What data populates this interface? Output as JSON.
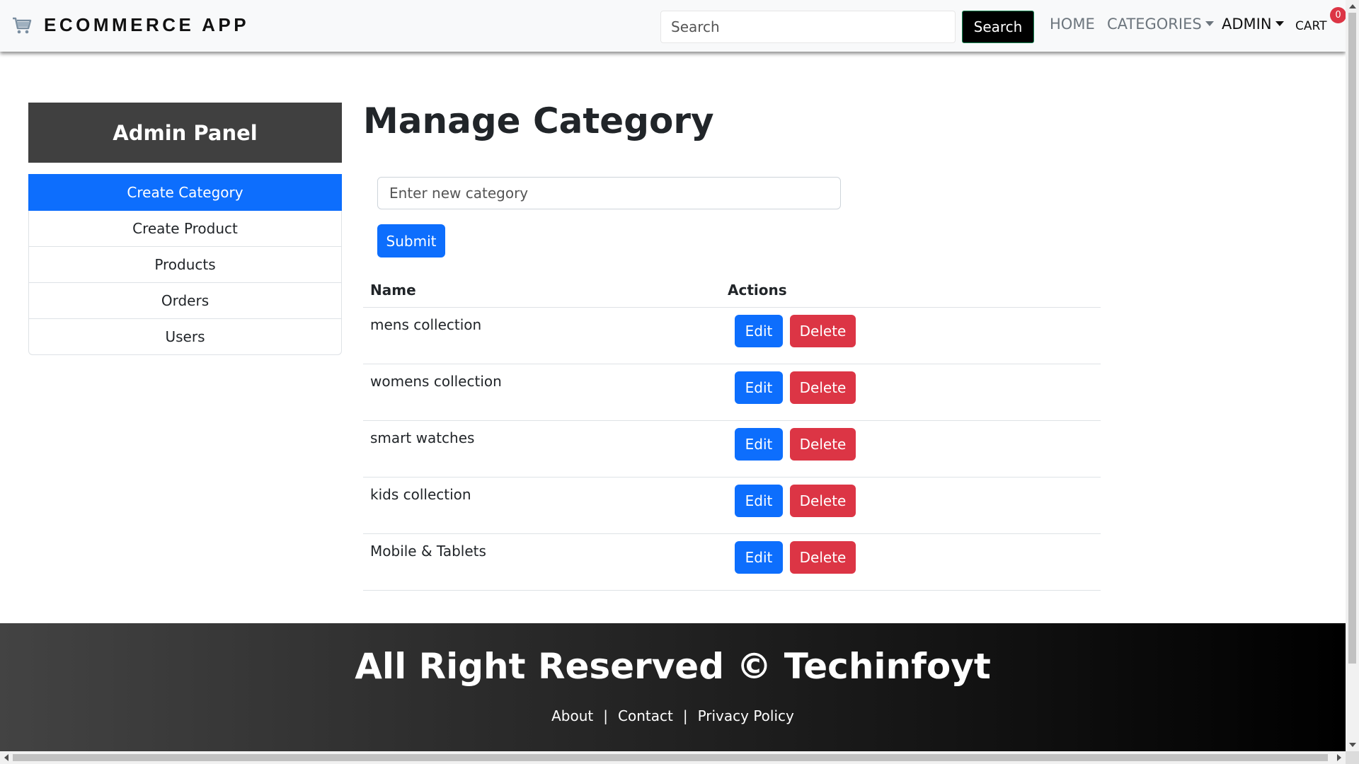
{
  "navbar": {
    "brand": "ECOMMERCE APP",
    "brand_icon": "shopping-cart-icon",
    "search_placeholder": "Search",
    "search_button": "Search",
    "links": {
      "home": "HOME",
      "categories": "CATEGORIES",
      "admin": "ADMIN",
      "cart": "CART"
    },
    "cart_count": "0"
  },
  "sidebar": {
    "title": "Admin Panel",
    "items": [
      {
        "label": "Create Category",
        "active": true
      },
      {
        "label": "Create Product",
        "active": false
      },
      {
        "label": "Products",
        "active": false
      },
      {
        "label": "Orders",
        "active": false
      },
      {
        "label": "Users",
        "active": false
      }
    ]
  },
  "main": {
    "title": "Manage Category",
    "input_placeholder": "Enter new category",
    "submit_label": "Submit",
    "table": {
      "headers": [
        "Name",
        "Actions"
      ],
      "rows": [
        {
          "name": "mens collection",
          "edit": "Edit",
          "delete": "Delete"
        },
        {
          "name": "womens collection",
          "edit": "Edit",
          "delete": "Delete"
        },
        {
          "name": "smart watches",
          "edit": "Edit",
          "delete": "Delete"
        },
        {
          "name": "kids collection",
          "edit": "Edit",
          "delete": "Delete"
        },
        {
          "name": "Mobile & Tablets",
          "edit": "Edit",
          "delete": "Delete"
        }
      ]
    }
  },
  "footer": {
    "title": "All Right Reserved © Techinfoyt",
    "links": [
      "About",
      "Contact",
      "Privacy Policy"
    ],
    "separator": "|"
  },
  "colors": {
    "primary": "#0d6efd",
    "danger": "#dc3545",
    "admin_header_bg": "#404040",
    "footer_gradient_start": "#434343",
    "footer_gradient_end": "#000000"
  }
}
